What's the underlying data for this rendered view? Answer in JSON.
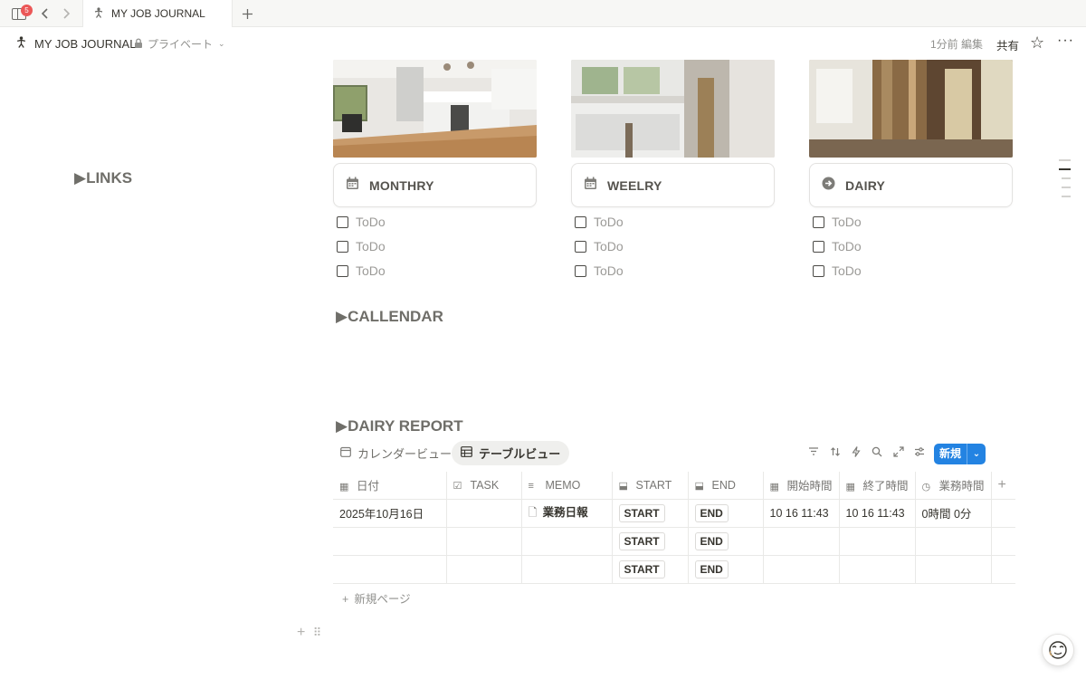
{
  "tabbar": {
    "badge_count": "5",
    "tab_title": "MY JOB JOURNAL",
    "new_tab_icon": "plus-icon"
  },
  "topbar": {
    "title": "MY JOB JOURNAL",
    "privacy": "プライベート",
    "edited": "1分前 編集",
    "share": "共有"
  },
  "sections": {
    "links": "▶LINKS",
    "calendar": "▶CALLENDAR",
    "report": "▶DAIRY REPORT"
  },
  "cards": [
    {
      "label": "MONTHRY",
      "icon": "calendar-icon",
      "todos": [
        "ToDo",
        "ToDo",
        "ToDo"
      ]
    },
    {
      "label": "WEELRY",
      "icon": "calendar-icon",
      "todos": [
        "ToDo",
        "ToDo",
        "ToDo"
      ]
    },
    {
      "label": "DAIRY",
      "icon": "arrow-circle-icon",
      "todos": [
        "ToDo",
        "ToDo",
        "ToDo"
      ]
    }
  ],
  "database": {
    "views": [
      "カレンダービュー",
      "テーブルビュー"
    ],
    "active_view": "テーブルビュー",
    "new_button": "新規",
    "columns": [
      "日付",
      "TASK",
      "MEMO",
      "START",
      "END",
      "開始時間",
      "終了時間",
      "業務時間"
    ],
    "rows": [
      {
        "date": "2025年10月16日",
        "task": "",
        "memo": "業務日報",
        "start": "START",
        "end": "END",
        "begin": "10 16 11:43",
        "finish": "10 16 11:43",
        "duration": "0時間 0分"
      },
      {
        "date": "",
        "task": "",
        "memo": "",
        "start": "START",
        "end": "END",
        "begin": "",
        "finish": "",
        "duration": ""
      },
      {
        "date": "",
        "task": "",
        "memo": "",
        "start": "START",
        "end": "END",
        "begin": "",
        "finish": "",
        "duration": ""
      }
    ],
    "new_page": "新規ページ"
  }
}
